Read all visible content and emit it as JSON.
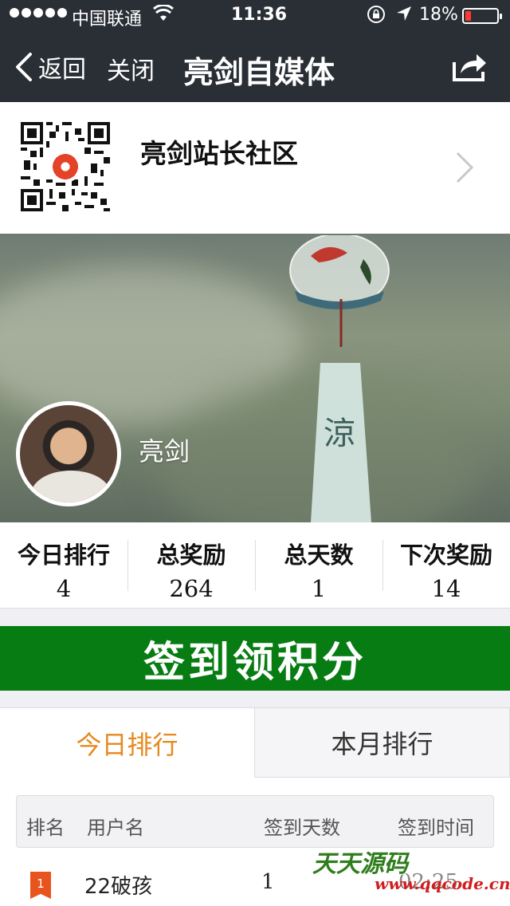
{
  "status_bar": {
    "carrier": "中国联通",
    "time": "11:36",
    "battery": "18%",
    "battery_level": 0.18
  },
  "nav": {
    "back_label": "返回",
    "close_label": "关闭",
    "title": "亮剑自媒体"
  },
  "account": {
    "name": "亮剑站长社区"
  },
  "profile": {
    "name": "亮剑",
    "banner_glyph": "涼"
  },
  "stats": [
    {
      "label": "今日排行",
      "value": "4"
    },
    {
      "label": "总奖励",
      "value": "264"
    },
    {
      "label": "总天数",
      "value": "1"
    },
    {
      "label": "下次奖励",
      "value": "14"
    }
  ],
  "signin_label": "签到领积分",
  "tabs": [
    {
      "label": "今日排行",
      "active": true
    },
    {
      "label": "本月排行",
      "active": false
    }
  ],
  "table": {
    "headers": [
      "排名",
      "用户名",
      "签到天数",
      "签到时间"
    ],
    "rows": [
      {
        "rank": "1",
        "name": "22破孩",
        "days": "1",
        "time": "02:25"
      }
    ]
  },
  "watermark": {
    "line1": "天天源码",
    "line2": "www.qqcode.cn"
  },
  "colors": {
    "nav_bg": "#2a2f36",
    "signin_green": "#067c12",
    "active_tab": "#e58a1e",
    "rank_flag": "#e8541e",
    "battery_low": "#ff3b30"
  }
}
